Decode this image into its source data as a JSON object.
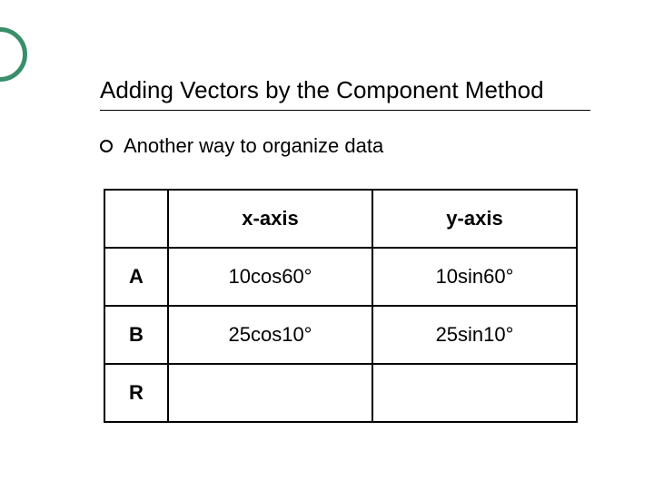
{
  "slide": {
    "title": "Adding Vectors by the Component Method",
    "bullet": "Another way to organize data"
  },
  "table": {
    "headers": {
      "col0": "",
      "col1": "x-axis",
      "col2": "y-axis"
    },
    "rows": [
      {
        "label": "A",
        "x": "10cos60°",
        "y": "10sin60°"
      },
      {
        "label": "B",
        "x": "25cos10°",
        "y": "25sin10°"
      },
      {
        "label": "R",
        "x": "",
        "y": ""
      }
    ]
  },
  "chart_data": {
    "type": "table",
    "title": "Adding Vectors by the Component Method",
    "columns": [
      "",
      "x-axis",
      "y-axis"
    ],
    "rows": [
      [
        "A",
        "10cos60°",
        "10sin60°"
      ],
      [
        "B",
        "25cos10°",
        "25sin10°"
      ],
      [
        "R",
        "",
        ""
      ]
    ]
  }
}
